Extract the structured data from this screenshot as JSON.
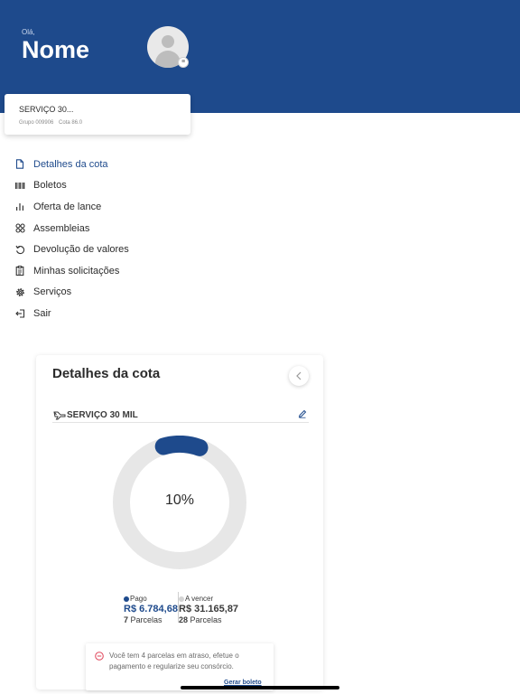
{
  "header": {
    "greeting": "Olá,",
    "user_name": "Nome",
    "background_color": "#1e4a8c"
  },
  "contract_card": {
    "title": "SERVIÇO 30...",
    "group": "Grupo 009906",
    "quota": "Cota 86.0"
  },
  "menu": {
    "items": [
      {
        "label": "Detalhes da cota",
        "icon": "document-icon",
        "active": true
      },
      {
        "label": "Boletos",
        "icon": "barcode-icon"
      },
      {
        "label": "Oferta de lance",
        "icon": "bar-chart-icon"
      },
      {
        "label": "Assembleias",
        "icon": "group-icon"
      },
      {
        "label": "Devolução de valores",
        "icon": "refund-icon"
      },
      {
        "label": "Minhas solicitações",
        "icon": "clipboard-icon"
      },
      {
        "label": "Serviços",
        "icon": "gear-icon"
      },
      {
        "label": "Sair",
        "icon": "logout-icon"
      }
    ]
  },
  "details": {
    "title": "Detalhes da cota",
    "service_name": "SERVIÇO 30 MIL",
    "percent_paid_label": "10%",
    "progress_fraction": 0.1,
    "paid": {
      "label": "Pago",
      "amount": "R$ 6.784,68",
      "parcels_count": "7",
      "parcels_label": "Parcelas",
      "color": "#1e4a8c"
    },
    "due": {
      "label": "A vencer",
      "amount": "R$ 31.165,87",
      "parcels_count": "28",
      "parcels_label": "Parcelas",
      "color": "#d4d4d4"
    },
    "alert": {
      "text": "Você tem 4 parcelas em atraso, efetue o pagamento e regularize seu consórcio.",
      "link": "Gerar boleto",
      "color": "#e0455a"
    }
  }
}
